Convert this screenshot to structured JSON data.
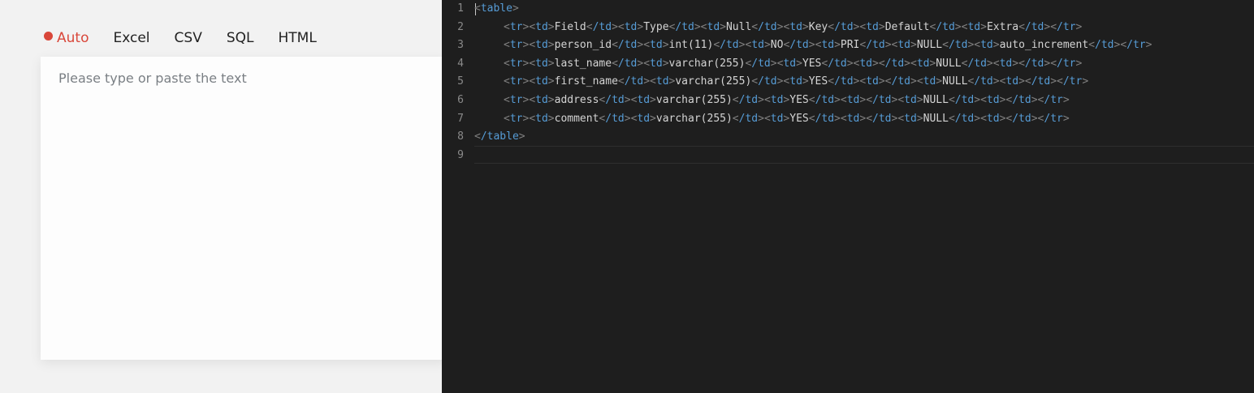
{
  "tabs": [
    {
      "label": "Auto",
      "active": true
    },
    {
      "label": "Excel",
      "active": false
    },
    {
      "label": "CSV",
      "active": false
    },
    {
      "label": "SQL",
      "active": false
    },
    {
      "label": "HTML",
      "active": false
    }
  ],
  "input": {
    "placeholder": "Please type or paste the text",
    "value": ""
  },
  "editor": {
    "line_numbers": [
      "1",
      "2",
      "3",
      "4",
      "5",
      "6",
      "7",
      "8",
      "9"
    ],
    "open_tag": "table",
    "close_tag": "/table",
    "rows": [
      [
        "Field",
        "Type",
        "Null",
        "Key",
        "Default",
        "Extra"
      ],
      [
        "person_id",
        "int(11)",
        "NO",
        "PRI",
        "NULL",
        "auto_increment"
      ],
      [
        "last_name",
        "varchar(255)",
        "YES",
        "",
        "NULL",
        ""
      ],
      [
        "first_name",
        "varchar(255)",
        "YES",
        "",
        "NULL",
        ""
      ],
      [
        "address",
        "varchar(255)",
        "YES",
        "",
        "NULL",
        ""
      ],
      [
        "comment",
        "varchar(255)",
        "YES",
        "",
        "NULL",
        ""
      ]
    ]
  },
  "colors": {
    "accent": "#d9473a",
    "editor_bg": "#1e1e1e",
    "tag": "#569cd6",
    "bracket": "#808080",
    "text": "#d4d4d4"
  }
}
